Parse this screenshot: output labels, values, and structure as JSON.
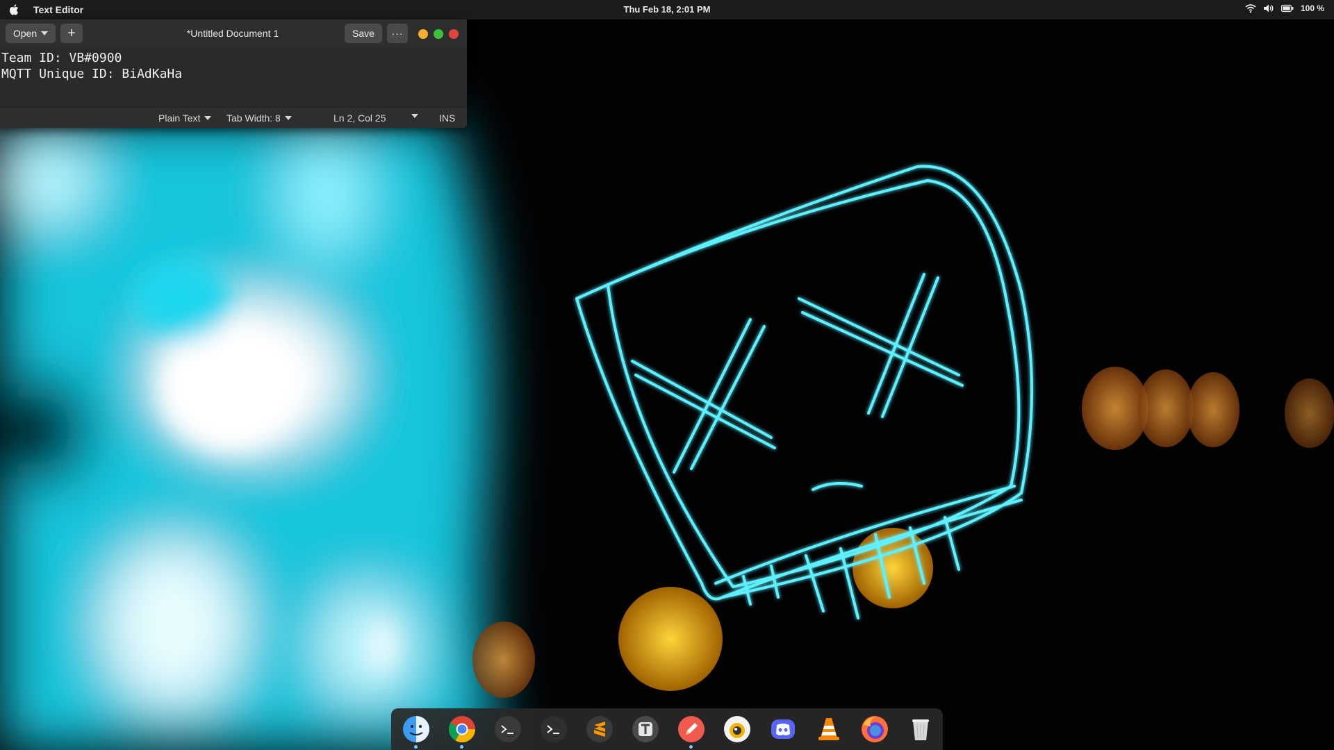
{
  "top_bar": {
    "app_name": "Text Editor",
    "clock": "Thu Feb 18,  2:01 PM",
    "battery": "100 %"
  },
  "editor": {
    "open_label": "Open",
    "new_tab_label": "+",
    "title": "*Untitled Document 1",
    "save_label": "Save",
    "menu_label": "···",
    "lines": [
      "Team ID: VB#0900",
      "MQTT Unique ID: BiAdKaHa"
    ],
    "status": {
      "language": "Plain Text",
      "tab_width": "Tab Width: 8",
      "cursor": "Ln 2, Col 25",
      "mode": "INS"
    }
  },
  "dock": {
    "items": [
      {
        "name": "finder-icon",
        "running": true
      },
      {
        "name": "chrome-icon",
        "running": true
      },
      {
        "name": "terminal-icon",
        "running": false
      },
      {
        "name": "terminal-alt-icon",
        "running": false
      },
      {
        "name": "sublime-text-icon",
        "running": false
      },
      {
        "name": "typora-icon",
        "running": false
      },
      {
        "name": "text-editor-icon",
        "running": true
      },
      {
        "name": "cheese-icon",
        "running": false
      },
      {
        "name": "discord-icon",
        "running": false
      },
      {
        "name": "vlc-icon",
        "running": false
      },
      {
        "name": "firefox-icon",
        "running": false
      },
      {
        "name": "trash-icon",
        "running": false
      }
    ]
  },
  "colors": {
    "window_bg": "#2b2b2b",
    "close": "#e0443c",
    "minimize": "#f0b12d",
    "maximize": "#3fbf3f",
    "neon": "#3fe6ff"
  }
}
